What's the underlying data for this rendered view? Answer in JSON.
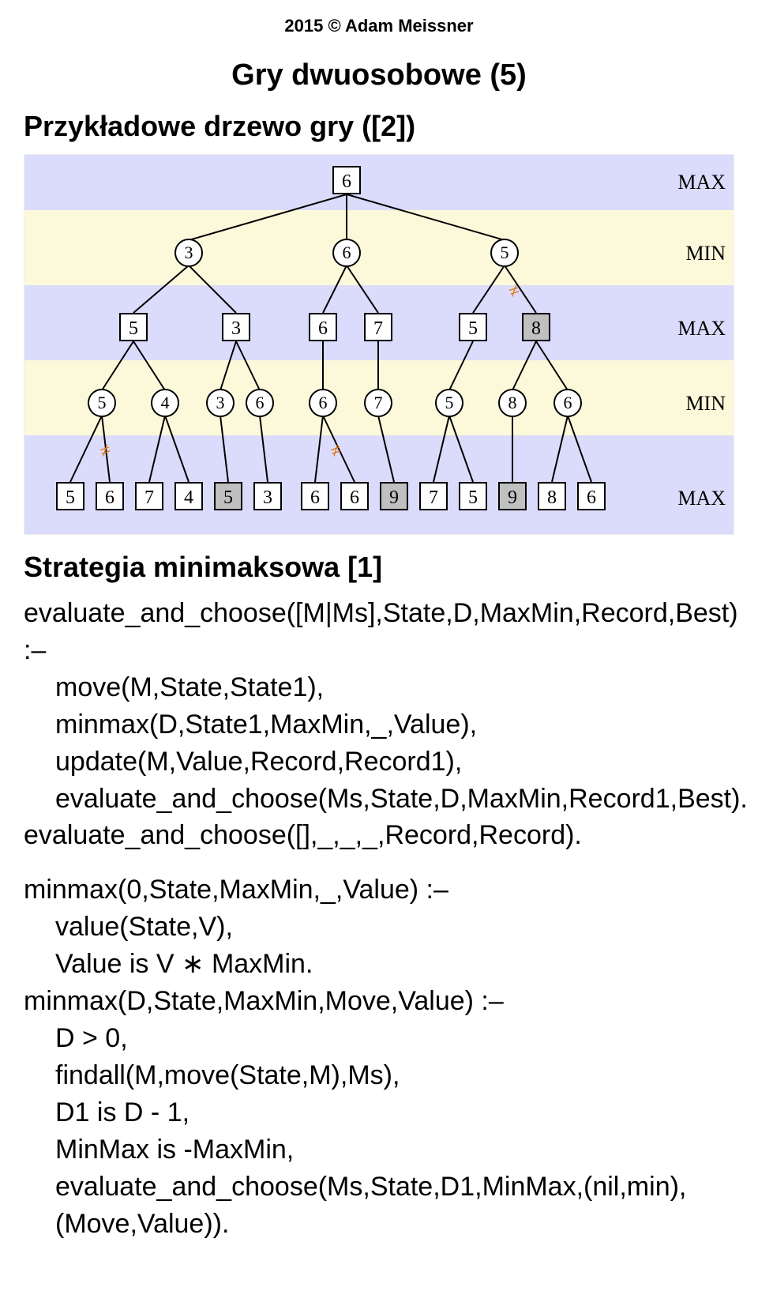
{
  "copyright": "2015 © Adam Meissner",
  "title": "Gry dwuosobowe (5)",
  "subtitle": "Przykładowe drzewo gry ([2])",
  "section_title": "Strategia minimaksowa [1]",
  "levels": {
    "l0": "MAX",
    "l1": "MIN",
    "l2": "MAX",
    "l3": "MIN",
    "l4": "MAX"
  },
  "tree": {
    "root": {
      "v": "6"
    },
    "l1": [
      {
        "v": "3"
      },
      {
        "v": "6"
      },
      {
        "v": "5"
      }
    ],
    "l2": [
      {
        "v": "5"
      },
      {
        "v": "3"
      },
      {
        "v": "6"
      },
      {
        "v": "7"
      },
      {
        "v": "5"
      },
      {
        "v": "8",
        "g": true
      }
    ],
    "l3": [
      {
        "v": "5"
      },
      {
        "v": "4"
      },
      {
        "v": "3"
      },
      {
        "v": "6"
      },
      {
        "v": "6"
      },
      {
        "v": "7"
      },
      {
        "v": "5"
      },
      {
        "v": "8"
      },
      {
        "v": "6"
      }
    ],
    "l4": [
      {
        "v": "5"
      },
      {
        "v": "6"
      },
      {
        "v": "7"
      },
      {
        "v": "4"
      },
      {
        "v": "5",
        "g": true
      },
      {
        "v": "3"
      },
      {
        "v": "6"
      },
      {
        "v": "6"
      },
      {
        "v": "9",
        "g": true
      },
      {
        "v": "7"
      },
      {
        "v": "5"
      },
      {
        "v": "9",
        "g": true
      },
      {
        "v": "8"
      },
      {
        "v": "6"
      }
    ]
  },
  "code": {
    "r1_head": "evaluate_and_choose([M|Ms],State,D,MaxMin,Record,Best) :–",
    "r1_b1": "move(M,State,State1),",
    "r1_b2": "minmax(D,State1,MaxMin,_,Value),",
    "r1_b3": "update(M,Value,Record,Record1),",
    "r1_b4": "evaluate_and_choose(Ms,State,D,MaxMin,Record1,Best).",
    "r1_base": "evaluate_and_choose([],_,_,_,Record,Record).",
    "r2_head": "minmax(0,State,MaxMin,_,Value) :–",
    "r2_b1": "value(State,V),",
    "r2_b2": "Value is V ∗ MaxMin.",
    "r3_head": "minmax(D,State,MaxMin,Move,Value) :–",
    "r3_b1": "D > 0,",
    "r3_b2": "findall(M,move(State,M),Ms),",
    "r3_b3": "D1 is D - 1,",
    "r3_b4": "MinMax is -MaxMin,",
    "r3_b5": "evaluate_and_choose(Ms,State,D1,MinMax,(nil,min),(Move,Value))."
  },
  "chart_data": {
    "type": "diagram",
    "description": "Alpha-beta / minimax game tree with 5 levels alternating MAX/MIN",
    "levels": [
      "MAX",
      "MIN",
      "MAX",
      "MIN",
      "MAX"
    ],
    "nodes": {
      "L0": [
        6
      ],
      "L1": [
        3,
        6,
        5
      ],
      "L2": [
        5,
        3,
        6,
        7,
        5,
        8
      ],
      "L3": [
        5,
        4,
        3,
        6,
        6,
        7,
        5,
        8,
        6
      ],
      "L4": [
        5,
        6,
        7,
        4,
        5,
        3,
        6,
        6,
        9,
        7,
        5,
        9,
        8,
        6
      ]
    },
    "highlighted_leaves_L4": [
      5,
      9,
      9
    ],
    "highlighted_L2": [
      8
    ],
    "pruned_edges": [
      "L1[2]-L2[5]",
      "L3[0]-L4[1]",
      "L3[4]-L4[8]"
    ]
  }
}
